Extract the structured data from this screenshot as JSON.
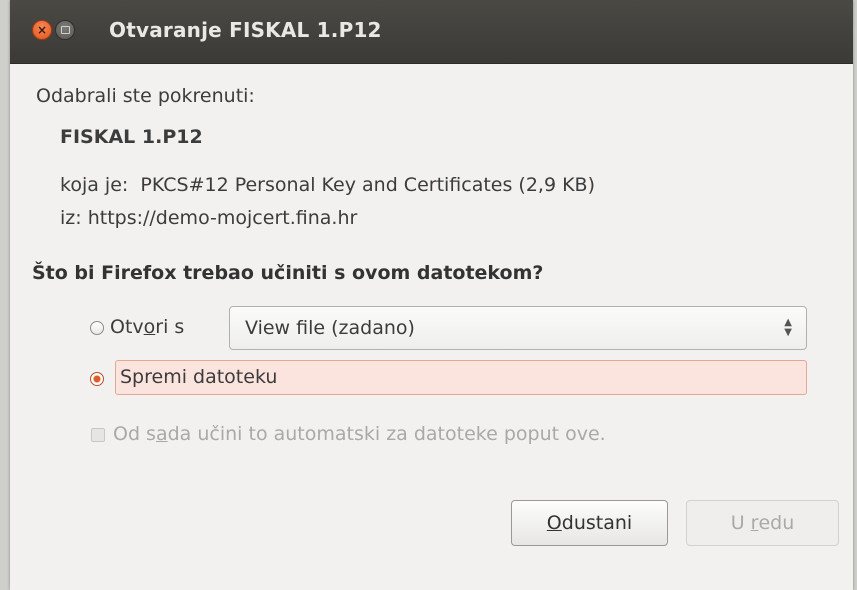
{
  "window": {
    "title": "Otvaranje FISKAL 1.P12",
    "close_glyph": "×"
  },
  "intro": "Odabrali ste pokrenuti:",
  "file": {
    "name": "FISKAL 1.P12",
    "type_label": "koja je:",
    "type_value": "PKCS#12 Personal Key and Certificates (2,9 KB)",
    "from_label": "iz:",
    "from_value": "https://demo-mojcert.fina.hr"
  },
  "question": "Što bi Firefox trebao učiniti s ovom datotekom?",
  "options": {
    "open_with": {
      "label_pre": "Otv",
      "label_mnemonic": "o",
      "label_post": "ri s",
      "selected": false,
      "app_value": "View file (zadano)"
    },
    "save_file": {
      "label": "Spremi datoteku",
      "selected": true
    },
    "auto": {
      "label_pre": "Od s",
      "label_mnemonic": "a",
      "label_post": "da učini to automatski za datoteke poput ove.",
      "checked": false,
      "enabled": false
    }
  },
  "buttons": {
    "cancel": {
      "mnemonic": "O",
      "rest": "dustani"
    },
    "ok": {
      "pre": "U ",
      "mnemonic": "r",
      "rest": "edu",
      "enabled": false
    }
  },
  "colors": {
    "titlebar": "#3b3a37",
    "accent": "#e05b2a",
    "selection_bg": "#fbe4dd"
  }
}
